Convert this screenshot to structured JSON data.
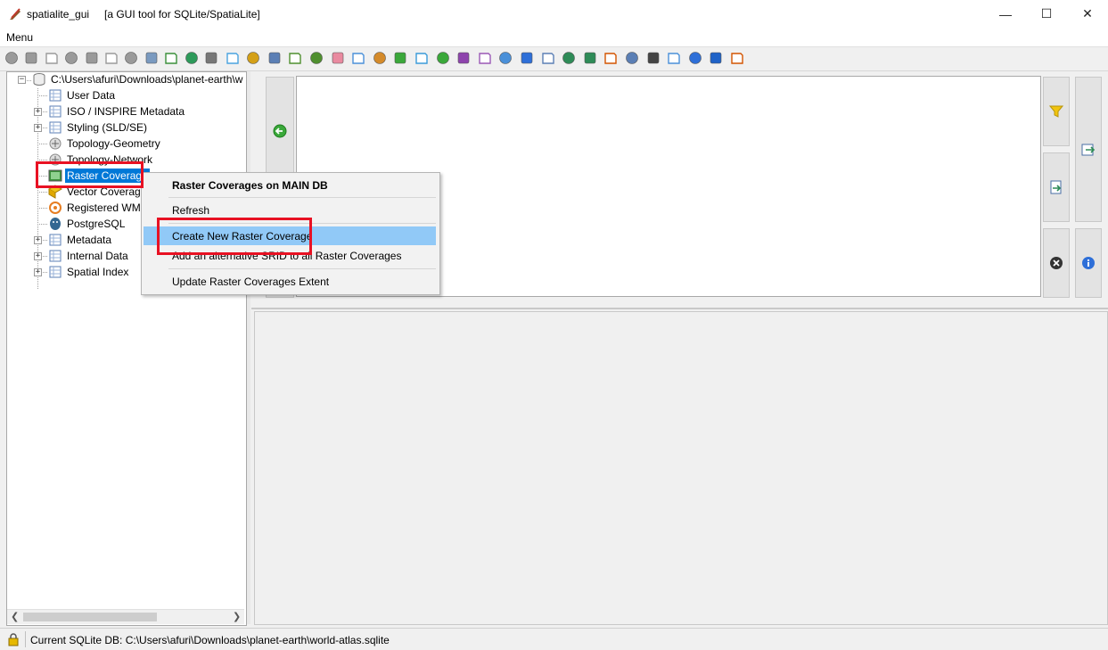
{
  "window": {
    "app_name": "spatialite_gui",
    "description": "[a GUI tool for SQLite/SpatiaLite]",
    "minimize": "—",
    "maximize": "☐",
    "close": "✕"
  },
  "menu": {
    "label": "Menu"
  },
  "tree": {
    "root": "C:\\Users\\afuri\\Downloads\\planet-earth\\w",
    "items": [
      {
        "label": "User Data"
      },
      {
        "label": "ISO / INSPIRE Metadata"
      },
      {
        "label": "Styling (SLD/SE)"
      },
      {
        "label": "Topology-Geometry"
      },
      {
        "label": "Topology-Network"
      },
      {
        "label": "Raster Coverage"
      },
      {
        "label": "Vector Coverage"
      },
      {
        "label": "Registered WMS"
      },
      {
        "label": "PostgreSQL"
      },
      {
        "label": "Metadata"
      },
      {
        "label": "Internal Data"
      },
      {
        "label": "Spatial Index"
      }
    ]
  },
  "context_menu": {
    "title": "Raster Coverages on MAIN DB",
    "items": [
      {
        "label": "Refresh"
      },
      {
        "label": "Create New Raster Coverage"
      },
      {
        "label": "Add an alternative SRID to all Raster Coverages"
      },
      {
        "label": "Update Raster Coverages Extent"
      }
    ]
  },
  "status": {
    "text": "Current SQLite DB: C:\\Users\\afuri\\Downloads\\planet-earth\\world-atlas.sqlite"
  },
  "colors": {
    "selection": "#0078d7",
    "menu_hover": "#91c9f7",
    "highlight_box": "#e81123"
  }
}
